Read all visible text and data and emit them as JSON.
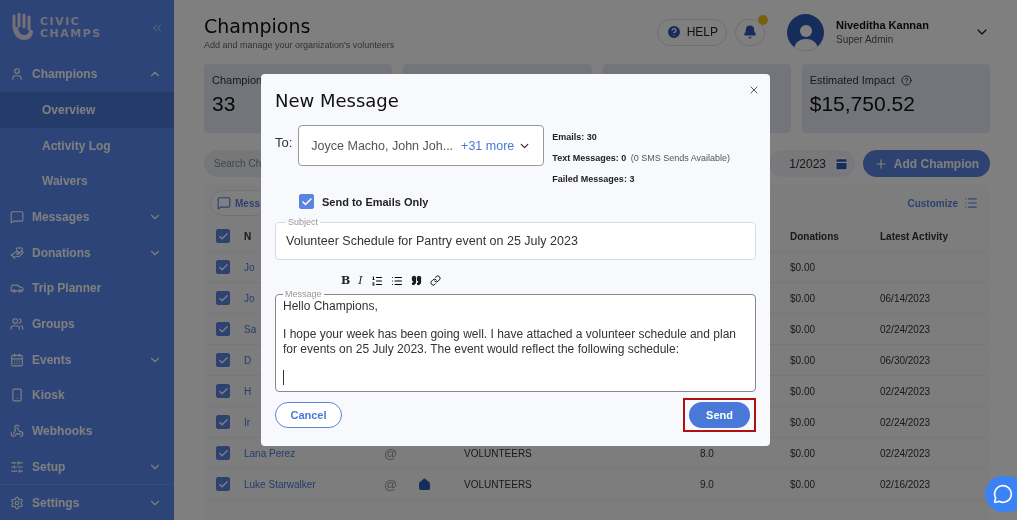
{
  "sidebar": {
    "logo": [
      "CIVIC",
      "CHAMPS"
    ],
    "items": [
      {
        "label": "Champions",
        "kind": "group",
        "expanded": true,
        "children": [
          {
            "label": "Overview",
            "selected": true
          },
          {
            "label": "Activity Log",
            "selected": false
          },
          {
            "label": "Waivers",
            "selected": false
          }
        ]
      },
      {
        "label": "Messages",
        "kind": "group",
        "expanded": false
      },
      {
        "label": "Donations",
        "kind": "group",
        "expanded": false
      },
      {
        "label": "Trip Planner",
        "kind": "link"
      },
      {
        "label": "Groups",
        "kind": "link"
      },
      {
        "label": "Events",
        "kind": "group",
        "expanded": false
      },
      {
        "label": "Kiosk",
        "kind": "link"
      },
      {
        "label": "Webhooks",
        "kind": "link"
      },
      {
        "label": "Setup",
        "kind": "group",
        "expanded": false
      },
      {
        "label": "Settings",
        "kind": "group",
        "expanded": false
      }
    ]
  },
  "header": {
    "title": "Champions",
    "subtitle": "Add and manage your organization's volunteers",
    "help": "HELP",
    "unread": true,
    "user_name": "Niveditha Kannan",
    "user_role": "Super Admin"
  },
  "stat_cards": [
    {
      "label": "Champion",
      "value": "33"
    },
    {
      "label": "Estimated Impact",
      "value": "$15,750.52"
    }
  ],
  "toolbar": {
    "search_placeholder": "Search Ch",
    "date": "1/2023",
    "add_button": "Add Champion",
    "messages_button": "Mess",
    "customize": "Customize"
  },
  "table": {
    "all_checked": true,
    "columns": [
      "N",
      "Donations",
      "Latest Activity"
    ],
    "rows": [
      {
        "checked": true,
        "name": "Jo",
        "donations": "$0.00"
      },
      {
        "checked": true,
        "name": "Jo",
        "donations": "$0.00",
        "latest_activity": "06/14/2023"
      },
      {
        "checked": true,
        "name": "Sa",
        "donations": "$0.00",
        "latest_activity": "02/24/2023"
      },
      {
        "checked": true,
        "name": "D",
        "donations": "$0.00",
        "latest_activity": "06/30/2023"
      },
      {
        "checked": true,
        "name": "H",
        "donations": "$0.00",
        "latest_activity": "02/24/2023"
      },
      {
        "checked": true,
        "name": "Ir",
        "donations": "$0.00",
        "latest_activity": "02/24/2023"
      },
      {
        "checked": true,
        "name": "Lana Perez",
        "contact": "@",
        "home": false,
        "group": "VOLUNTEERS",
        "hours": "8.0",
        "donations": "$0.00",
        "latest_activity": "02/24/2023"
      },
      {
        "checked": true,
        "name": "Luke Starwalker",
        "contact": "@",
        "home": true,
        "group": "VOLUNTEERS",
        "hours": "9.0",
        "donations": "$0.00",
        "latest_activity": "02/16/2023"
      }
    ]
  },
  "modal": {
    "title": "New Message",
    "to_label": "To:",
    "recipients": "Joyce Macho, John Joh...",
    "more": "+31 more",
    "stats": [
      {
        "label": "Emails: 30"
      },
      {
        "label": "Text Messages: 0",
        "note": "(0 SMS Sends Available)"
      },
      {
        "label": "Failed Messages: 3"
      }
    ],
    "emails_only": {
      "label": "Send to Emails Only",
      "checked": true
    },
    "subject": {
      "label": "Subject",
      "value": "Volunteer Schedule for Pantry event on 25 July 2023"
    },
    "format_tools": [
      {
        "kind": "bold",
        "label": "B"
      },
      {
        "kind": "italic",
        "label": "I"
      },
      {
        "kind": "numbered-list"
      },
      {
        "kind": "bullet-list"
      },
      {
        "kind": "quote"
      },
      {
        "kind": "link"
      }
    ],
    "message": {
      "label": "Message",
      "paragraphs": [
        "Hello Champions,",
        "I hope your week has been going well. I have attached a volunteer schedule and plan for events on 25 July 2023. The event would reflect the following schedule:"
      ]
    },
    "cancel": "Cancel",
    "send": "Send",
    "send_highlighted": true
  }
}
